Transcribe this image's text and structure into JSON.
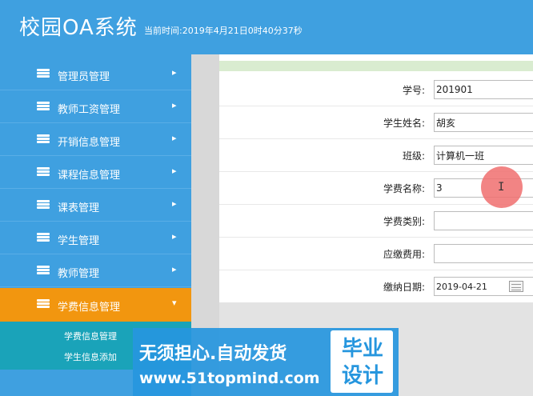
{
  "header": {
    "app_title": "校园OA系统",
    "clock": "当前时间:2019年4月21日0时40分37秒"
  },
  "sidebar": {
    "items": [
      {
        "label": "管理员管理",
        "arrow": "▸"
      },
      {
        "label": "教师工资管理",
        "arrow": "▸"
      },
      {
        "label": "开销信息管理",
        "arrow": "▸"
      },
      {
        "label": "课程信息管理",
        "arrow": "▸"
      },
      {
        "label": "课表管理",
        "arrow": "▸"
      },
      {
        "label": "学生管理",
        "arrow": "▸"
      },
      {
        "label": "教师管理",
        "arrow": "▸"
      },
      {
        "label": "学费信息管理",
        "arrow": "▾",
        "active": true
      }
    ],
    "submenu": [
      {
        "label": "学费信息管理"
      },
      {
        "label": "学生信息添加"
      }
    ]
  },
  "form": {
    "fields": [
      {
        "label": "学号:",
        "value": "201901"
      },
      {
        "label": "学生姓名:",
        "value": "胡亥"
      },
      {
        "label": "班级:",
        "value": "计算机一班"
      },
      {
        "label": "学费名称:",
        "value": "3"
      },
      {
        "label": "学费类别:",
        "value": ""
      },
      {
        "label": "应缴费用:",
        "value": ""
      },
      {
        "label": "缴纳日期:",
        "value": "2019-04-21"
      }
    ]
  },
  "cursor": {
    "glyph": "I"
  },
  "watermark": {
    "line1": "无须担心.自动发货",
    "line2": "www.51topmind.com",
    "badge": "毕业设计"
  },
  "colors": {
    "header_bg": "#3fa0e0",
    "active_item": "#f2960f",
    "submenu_bg": "#1aa3b9",
    "green_bar": "#d9ecd0"
  }
}
